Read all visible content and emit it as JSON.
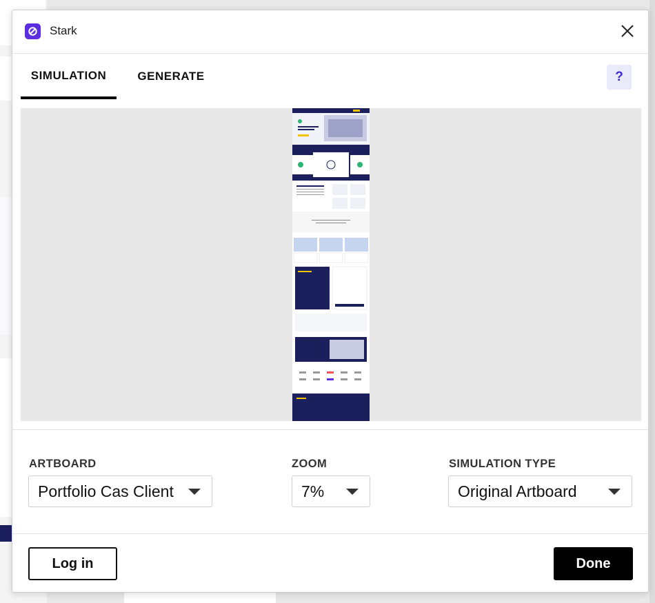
{
  "window": {
    "title": "Stark"
  },
  "tabs": [
    {
      "label": "SIMULATION",
      "active": true
    },
    {
      "label": "GENERATE",
      "active": false
    }
  ],
  "help": {
    "label": "?"
  },
  "preview": {},
  "controls": {
    "artboard": {
      "label": "ARTBOARD",
      "value": "Portfolio Cas Client"
    },
    "zoom": {
      "label": "ZOOM",
      "value": "7%"
    },
    "simulation_type": {
      "label": "SIMULATION TYPE",
      "value": "Original Artboard"
    }
  },
  "footer": {
    "login_label": "Log in",
    "done_label": "Done"
  },
  "colors": {
    "brand": "#5b2fe0",
    "accent_help": "#3b2bd0",
    "preview_navy": "#1b1f5c"
  }
}
